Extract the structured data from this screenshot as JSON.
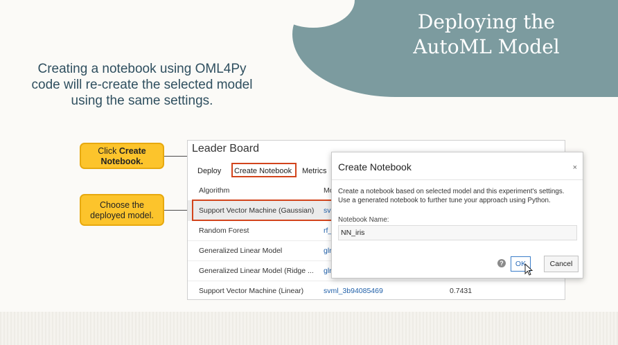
{
  "slide": {
    "title_line1": "Deploying the",
    "title_line2": "AutoML Model",
    "subtitle": "Creating a notebook using OML4Py code will re-create the selected model using the same settings."
  },
  "callouts": {
    "first_prefix": "Click ",
    "first_bold": "Create Notebook.",
    "second": "Choose the deployed model."
  },
  "leaderboard": {
    "title": "Leader Board",
    "actions": {
      "deploy": "Deploy",
      "create_notebook": "Create Notebook",
      "metrics": "Metrics"
    },
    "columns": {
      "algorithm": "Algorithm",
      "model_name_partial": "Mo"
    },
    "rows": [
      {
        "algorithm": "Support Vector Machine (Gaussian)",
        "model": "svr",
        "metric": ""
      },
      {
        "algorithm": "Random Forest",
        "model": "rf_",
        "metric": ""
      },
      {
        "algorithm": "Generalized Linear Model",
        "model": "glr",
        "metric": ""
      },
      {
        "algorithm": "Generalized Linear Model (Ridge ...",
        "model": "glr",
        "metric": ""
      },
      {
        "algorithm": "Support Vector Machine (Linear)",
        "model": "svml_3b94085469",
        "metric": "0.7431"
      }
    ]
  },
  "dialog": {
    "title": "Create Notebook",
    "close": "×",
    "description": "Create a notebook based on selected model and this experiment's settings. Use a generated notebook to further tune your approach using Python.",
    "name_label": "Notebook Name:",
    "name_value": "NN_iris",
    "help": "?",
    "ok": "OK",
    "cancel": "Cancel"
  },
  "colors": {
    "accent_highlight": "#d2441c",
    "callout": "#fcc42c",
    "teal": "#7c9b9f",
    "link": "#1f5fa8"
  }
}
